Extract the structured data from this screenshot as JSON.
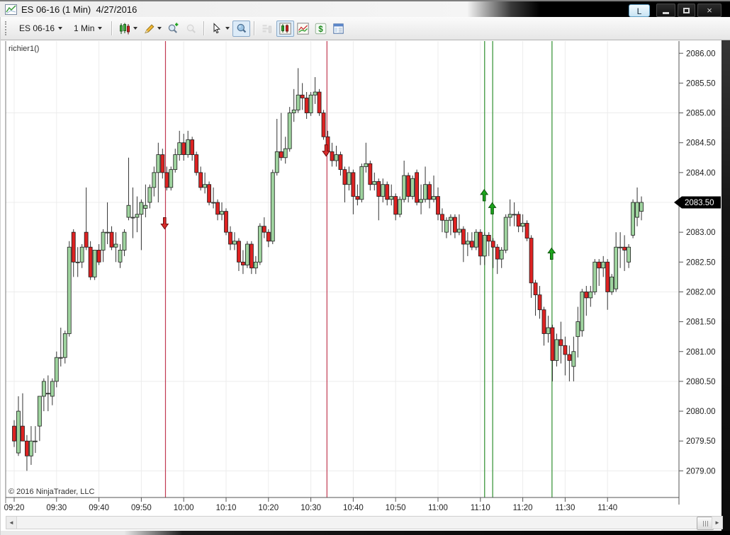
{
  "titlebar": {
    "icon": "chart-window-icon",
    "title": "ES 06-16 (1 Min)  4/27/2016",
    "link_button_label": "L",
    "window_buttons": [
      "minimize",
      "maximize",
      "close"
    ]
  },
  "toolbar": {
    "items": [
      {
        "type": "dropdown",
        "name": "instrument-dropdown",
        "label": "ES 06-16"
      },
      {
        "type": "dropdown",
        "name": "interval-dropdown",
        "label": "1 Min"
      },
      {
        "type": "sep"
      },
      {
        "type": "icon",
        "name": "bar-type-icon",
        "caret": true
      },
      {
        "type": "icon",
        "name": "drawing-tools-icon",
        "caret": true
      },
      {
        "type": "icon",
        "name": "zoom-in-icon"
      },
      {
        "type": "icon",
        "name": "zoom-out-icon",
        "state": "disabled"
      },
      {
        "type": "sep"
      },
      {
        "type": "icon",
        "name": "cursor-icon",
        "caret": true
      },
      {
        "type": "icon",
        "name": "crosshair-icon",
        "state": "active"
      },
      {
        "type": "sep"
      },
      {
        "type": "icon",
        "name": "chart-trader-icon",
        "state": "disabled"
      },
      {
        "type": "icon",
        "name": "data-series-icon",
        "state": "active"
      },
      {
        "type": "icon",
        "name": "indicators-icon"
      },
      {
        "type": "icon",
        "name": "strategies-icon"
      },
      {
        "type": "icon",
        "name": "output-icon"
      }
    ]
  },
  "chart_data": {
    "type": "candlestick",
    "instrument": "ES 06-16",
    "interval": "1 Min",
    "date": "4/27/2016",
    "indicator_label": "richier1()",
    "copyright": "© 2016 NinjaTrader, LLC",
    "start_time": "09:20",
    "interval_min": 1,
    "last_price_label": "2083.50",
    "ylim": [
      2078.55,
      2086.25
    ],
    "x_axis": {
      "ticks": [
        "09:20",
        "09:30",
        "09:40",
        "09:50",
        "10:00",
        "10:10",
        "10:20",
        "10:30",
        "10:40",
        "10:50",
        "11:00",
        "11:10",
        "11:20",
        "11:30",
        "11:40"
      ]
    },
    "y_axis": {
      "ticks": [
        "2086.00",
        "2085.50",
        "2085.00",
        "2084.50",
        "2084.00",
        "2083.50",
        "2083.00",
        "2082.50",
        "2082.00",
        "2081.50",
        "2081.00",
        "2080.50",
        "2080.00",
        "2079.50",
        "2079.00"
      ]
    },
    "grid_prices": [
      2085.0,
      2083.5,
      2082.0,
      2080.5,
      2079.0
    ],
    "colors": {
      "up_candle": "#9fd49f",
      "down_candle": "#dd2222",
      "candle_border": "#1c1c1c",
      "wick": "#333333",
      "red_line": "#c13a52",
      "green_line": "#2f8f2f",
      "up_arrow": "#1ca51c",
      "down_arrow": "#d92b2b",
      "badge_bg": "#000000",
      "badge_text": "#ffffff"
    },
    "vlines": [
      {
        "minute": 35.7,
        "color": "red_line"
      },
      {
        "minute": 73.8,
        "color": "red_line"
      },
      {
        "minute": 111.0,
        "color": "green_line"
      },
      {
        "minute": 112.9,
        "color": "green_line"
      },
      {
        "minute": 126.9,
        "color": "green_line"
      }
    ],
    "markers": [
      {
        "minute": 35.5,
        "price": 2083.15,
        "dir": "down"
      },
      {
        "minute": 73.6,
        "price": 2084.37,
        "dir": "down"
      },
      {
        "minute": 110.9,
        "price": 2083.62,
        "dir": "up"
      },
      {
        "minute": 112.8,
        "price": 2083.4,
        "dir": "up"
      },
      {
        "minute": 126.8,
        "price": 2082.64,
        "dir": "up"
      }
    ],
    "candles": [
      [
        2079.75,
        2079.85,
        2079.4,
        2079.5
      ],
      [
        2079.3,
        2080.25,
        2079.25,
        2080.0
      ],
      [
        2079.75,
        2080.3,
        2079.5,
        2079.5
      ],
      [
        2079.5,
        2079.6,
        2079.0,
        2079.25
      ],
      [
        2079.25,
        2079.75,
        2079.1,
        2079.5
      ],
      [
        2079.5,
        2079.75,
        2079.3,
        2079.5
      ],
      [
        2079.75,
        2080.25,
        2079.5,
        2080.25
      ],
      [
        2080.25,
        2080.55,
        2080.0,
        2080.5
      ],
      [
        2080.3,
        2080.6,
        2080.0,
        2080.3
      ],
      [
        2080.25,
        2080.55,
        2080.1,
        2080.5
      ],
      [
        2080.5,
        2081.0,
        2080.4,
        2080.9
      ],
      [
        2080.9,
        2081.4,
        2080.75,
        2080.9
      ],
      [
        2080.9,
        2081.35,
        2080.8,
        2081.3
      ],
      [
        2081.3,
        2082.85,
        2081.25,
        2082.75
      ],
      [
        2083.0,
        2083.05,
        2082.25,
        2082.5
      ],
      [
        2082.5,
        2082.75,
        2082.25,
        2082.5
      ],
      [
        2082.5,
        2082.8,
        2082.4,
        2082.75
      ],
      [
        2083.0,
        2083.75,
        2082.7,
        2082.75
      ],
      [
        2082.75,
        2082.85,
        2082.2,
        2082.25
      ],
      [
        2082.25,
        2082.7,
        2082.2,
        2082.7
      ],
      [
        2082.7,
        2082.8,
        2082.45,
        2082.5
      ],
      [
        2082.7,
        2083.05,
        2082.5,
        2083.0
      ],
      [
        2083.0,
        2083.5,
        2082.8,
        2083.0
      ],
      [
        2083.0,
        2083.1,
        2082.7,
        2082.75
      ],
      [
        2082.75,
        2083.0,
        2082.5,
        2082.8
      ],
      [
        2082.5,
        2082.8,
        2082.4,
        2082.7
      ],
      [
        2082.7,
        2083.05,
        2082.6,
        2083.0
      ],
      [
        2083.25,
        2084.25,
        2083.2,
        2083.45
      ],
      [
        2083.25,
        2083.75,
        2082.9,
        2083.25
      ],
      [
        2083.25,
        2083.6,
        2083.0,
        2083.3
      ],
      [
        2083.3,
        2083.55,
        2082.7,
        2083.5
      ],
      [
        2083.4,
        2083.8,
        2083.25,
        2083.45
      ],
      [
        2083.5,
        2083.8,
        2083.4,
        2083.75
      ],
      [
        2083.75,
        2084.1,
        2083.6,
        2084.0
      ],
      [
        2084.0,
        2084.5,
        2083.5,
        2084.3
      ],
      [
        2084.3,
        2084.4,
        2083.9,
        2084.0
      ],
      [
        2084.0,
        2084.1,
        2083.7,
        2083.75
      ],
      [
        2083.75,
        2084.1,
        2083.7,
        2084.05
      ],
      [
        2084.05,
        2084.4,
        2084.0,
        2084.3
      ],
      [
        2084.3,
        2084.7,
        2084.2,
        2084.5
      ],
      [
        2084.5,
        2084.65,
        2084.2,
        2084.3
      ],
      [
        2084.3,
        2084.7,
        2084.25,
        2084.55
      ],
      [
        2084.55,
        2084.6,
        2084.2,
        2084.3
      ],
      [
        2084.3,
        2084.35,
        2083.95,
        2084.0
      ],
      [
        2084.0,
        2084.1,
        2083.7,
        2083.75
      ],
      [
        2083.75,
        2084.0,
        2083.65,
        2083.8
      ],
      [
        2083.8,
        2083.85,
        2083.45,
        2083.5
      ],
      [
        2083.5,
        2083.75,
        2083.4,
        2083.5
      ],
      [
        2083.5,
        2083.55,
        2083.2,
        2083.3
      ],
      [
        2083.3,
        2083.5,
        2083.2,
        2083.35
      ],
      [
        2083.35,
        2083.4,
        2082.95,
        2083.0
      ],
      [
        2083.0,
        2083.1,
        2082.7,
        2082.8
      ],
      [
        2082.8,
        2083.0,
        2082.7,
        2082.85
      ],
      [
        2082.85,
        2082.9,
        2082.35,
        2082.5
      ],
      [
        2082.5,
        2082.7,
        2082.3,
        2082.45
      ],
      [
        2082.45,
        2082.85,
        2082.4,
        2082.8
      ],
      [
        2082.8,
        2082.85,
        2082.3,
        2082.4
      ],
      [
        2082.4,
        2082.6,
        2082.3,
        2082.5
      ],
      [
        2082.5,
        2083.15,
        2082.45,
        2083.1
      ],
      [
        2083.1,
        2083.25,
        2082.9,
        2083.0
      ],
      [
        2083.0,
        2083.05,
        2082.75,
        2082.85
      ],
      [
        2082.85,
        2084.05,
        2082.8,
        2084.0
      ],
      [
        2084.0,
        2084.9,
        2083.95,
        2084.35
      ],
      [
        2084.35,
        2085.0,
        2084.2,
        2084.25
      ],
      [
        2084.25,
        2084.6,
        2084.15,
        2084.4
      ],
      [
        2084.4,
        2085.1,
        2084.35,
        2085.0
      ],
      [
        2085.0,
        2085.4,
        2084.85,
        2085.05
      ],
      [
        2085.05,
        2085.75,
        2085.0,
        2085.3
      ],
      [
        2085.3,
        2085.5,
        2085.05,
        2085.25
      ],
      [
        2085.25,
        2085.35,
        2084.9,
        2085.0
      ],
      [
        2085.0,
        2085.35,
        2084.95,
        2085.3
      ],
      [
        2085.3,
        2085.6,
        2085.15,
        2085.35
      ],
      [
        2085.35,
        2085.4,
        2084.95,
        2085.0
      ],
      [
        2085.0,
        2085.05,
        2084.55,
        2084.6
      ],
      [
        2084.6,
        2084.7,
        2084.3,
        2084.35
      ],
      [
        2084.35,
        2084.5,
        2084.1,
        2084.2
      ],
      [
        2084.2,
        2084.45,
        2084.1,
        2084.3
      ],
      [
        2084.3,
        2084.35,
        2083.95,
        2084.05
      ],
      [
        2084.05,
        2084.1,
        2083.5,
        2083.8
      ],
      [
        2083.8,
        2084.1,
        2083.7,
        2084.0
      ],
      [
        2084.0,
        2084.05,
        2083.3,
        2083.6
      ],
      [
        2083.6,
        2083.8,
        2083.45,
        2083.55
      ],
      [
        2083.55,
        2084.15,
        2083.5,
        2084.1
      ],
      [
        2084.1,
        2084.5,
        2084.0,
        2084.15
      ],
      [
        2084.15,
        2084.2,
        2083.7,
        2083.8
      ],
      [
        2083.8,
        2084.0,
        2083.7,
        2083.85
      ],
      [
        2083.85,
        2083.9,
        2083.2,
        2083.6
      ],
      [
        2083.6,
        2083.9,
        2083.5,
        2083.8
      ],
      [
        2083.8,
        2083.85,
        2083.45,
        2083.55
      ],
      [
        2083.55,
        2083.8,
        2083.45,
        2083.6
      ],
      [
        2083.6,
        2083.65,
        2083.2,
        2083.3
      ],
      [
        2083.3,
        2083.6,
        2083.25,
        2083.55
      ],
      [
        2083.55,
        2084.2,
        2083.5,
        2083.95
      ],
      [
        2083.95,
        2084.0,
        2083.5,
        2083.6
      ],
      [
        2083.6,
        2083.95,
        2083.55,
        2083.9
      ],
      [
        2084.0,
        2084.05,
        2083.45,
        2083.5
      ],
      [
        2083.5,
        2083.8,
        2083.3,
        2083.55
      ],
      [
        2083.55,
        2084.1,
        2083.5,
        2083.8
      ],
      [
        2083.8,
        2083.85,
        2083.4,
        2083.55
      ],
      [
        2083.55,
        2083.95,
        2083.5,
        2083.6
      ],
      [
        2083.6,
        2083.75,
        2083.2,
        2083.3
      ],
      [
        2083.3,
        2083.4,
        2083.0,
        2083.2
      ],
      [
        2083.0,
        2083.25,
        2082.9,
        2083.2
      ],
      [
        2083.2,
        2083.3,
        2082.95,
        2083.25
      ],
      [
        2083.25,
        2083.3,
        2082.9,
        2083.0
      ],
      [
        2083.0,
        2083.3,
        2082.95,
        2083.05
      ],
      [
        2083.05,
        2083.1,
        2082.5,
        2082.8
      ],
      [
        2082.8,
        2083.0,
        2082.6,
        2082.85
      ],
      [
        2082.85,
        2083.0,
        2082.7,
        2082.75
      ],
      [
        2082.75,
        2083.05,
        2082.7,
        2083.0
      ],
      [
        2083.0,
        2083.05,
        2082.45,
        2082.6
      ],
      [
        2082.6,
        2083.0,
        2082.45,
        2082.95
      ],
      [
        2082.95,
        2083.0,
        2082.6,
        2082.85
      ],
      [
        2082.85,
        2082.9,
        2082.4,
        2082.75
      ],
      [
        2082.75,
        2082.8,
        2082.3,
        2082.55
      ],
      [
        2082.55,
        2082.75,
        2082.4,
        2082.7
      ],
      [
        2082.7,
        2083.3,
        2082.65,
        2083.25
      ],
      [
        2083.25,
        2083.55,
        2083.1,
        2083.3
      ],
      [
        2083.3,
        2083.5,
        2083.1,
        2083.3
      ],
      [
        2083.3,
        2083.35,
        2083.0,
        2083.1
      ],
      [
        2083.1,
        2083.3,
        2083.0,
        2083.15
      ],
      [
        2083.15,
        2083.2,
        2082.85,
        2082.9
      ],
      [
        2082.9,
        2082.95,
        2081.9,
        2082.15
      ],
      [
        2082.15,
        2082.2,
        2081.6,
        2081.95
      ],
      [
        2081.95,
        2082.1,
        2081.55,
        2081.7
      ],
      [
        2081.7,
        2081.75,
        2081.1,
        2081.3
      ],
      [
        2081.3,
        2081.6,
        2081.15,
        2081.4
      ],
      [
        2081.4,
        2081.45,
        2080.5,
        2080.85
      ],
      [
        2080.85,
        2081.3,
        2080.75,
        2081.2
      ],
      [
        2081.2,
        2081.5,
        2080.8,
        2081.1
      ],
      [
        2081.1,
        2081.25,
        2080.6,
        2080.95
      ],
      [
        2080.95,
        2081.1,
        2080.5,
        2080.85
      ],
      [
        2080.75,
        2081.25,
        2080.5,
        2081.0
      ],
      [
        2081.25,
        2081.75,
        2080.9,
        2081.5
      ],
      [
        2081.35,
        2082.05,
        2081.25,
        2082.0
      ],
      [
        2082.0,
        2082.1,
        2081.6,
        2081.9
      ],
      [
        2081.9,
        2082.1,
        2081.75,
        2082.0
      ],
      [
        2082.0,
        2082.55,
        2081.95,
        2082.5
      ],
      [
        2082.5,
        2082.55,
        2082.1,
        2082.4
      ],
      [
        2082.4,
        2082.6,
        2082.25,
        2082.5
      ],
      [
        2082.5,
        2082.55,
        2081.7,
        2082.0
      ],
      [
        2082.0,
        2082.3,
        2081.95,
        2082.25
      ],
      [
        2082.05,
        2083.0,
        2082.0,
        2082.75
      ],
      [
        2082.75,
        2083.0,
        2082.4,
        2082.75
      ],
      [
        2082.75,
        2082.95,
        2082.35,
        2082.7
      ],
      [
        2082.5,
        2082.8,
        2082.4,
        2082.75
      ],
      [
        2082.95,
        2083.55,
        2082.9,
        2083.5
      ],
      [
        2083.25,
        2083.75,
        2083.1,
        2083.5
      ],
      [
        2083.35,
        2083.6,
        2083.2,
        2083.5
      ]
    ]
  },
  "scrollbar": {
    "present": true
  }
}
